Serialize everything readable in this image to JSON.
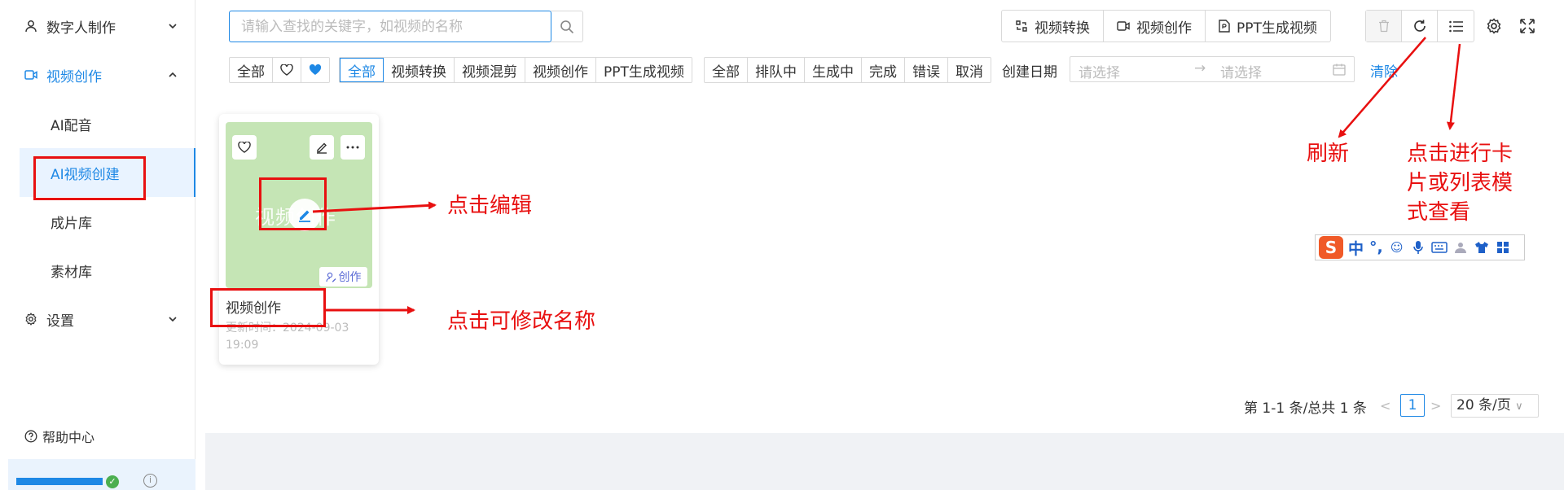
{
  "sidebar": {
    "items": [
      {
        "label": "数字人制作"
      },
      {
        "label": "视频创作"
      },
      {
        "label": "设置"
      }
    ],
    "sub_items": [
      {
        "label": "AI配音"
      },
      {
        "label": "AI视频创建"
      },
      {
        "label": "成片库"
      },
      {
        "label": "素材库"
      }
    ],
    "help": "帮助中心"
  },
  "search": {
    "placeholder": "请输入查找的关键字，如视频的名称"
  },
  "toolbar": {
    "convert": "视频转换",
    "create": "视频创作",
    "ppt": "PPT生成视频"
  },
  "filters": {
    "fav": [
      "全部"
    ],
    "type": [
      "全部",
      "视频转换",
      "视频混剪",
      "视频创作",
      "PPT生成视频"
    ],
    "status": [
      "全部",
      "排队中",
      "生成中",
      "完成",
      "错误",
      "取消"
    ],
    "date_label": "创建日期",
    "date_start_placeholder": "请选择",
    "date_end_placeholder": "请选择",
    "clear": "清除"
  },
  "card": {
    "thumb_text": "视频创作",
    "badge": "创作",
    "title": "视频创作",
    "time": "更新时间：2024-09-03 19:09"
  },
  "pagination": {
    "summary": "第 1-1 条/总共 1 条",
    "current": "1",
    "page_size": "20 条/页"
  },
  "annotations": {
    "click_edit": "点击编辑",
    "click_rename": "点击可修改名称",
    "refresh": "刷新",
    "card_list": "点击进行卡\n片或列表模\n式查看"
  },
  "ime": {
    "logo": "S",
    "lang": "中",
    "punct": "°,"
  },
  "colors": {
    "accent": "#1e88e5",
    "annotation": "#e81010",
    "thumb": "#c5e5b5"
  }
}
